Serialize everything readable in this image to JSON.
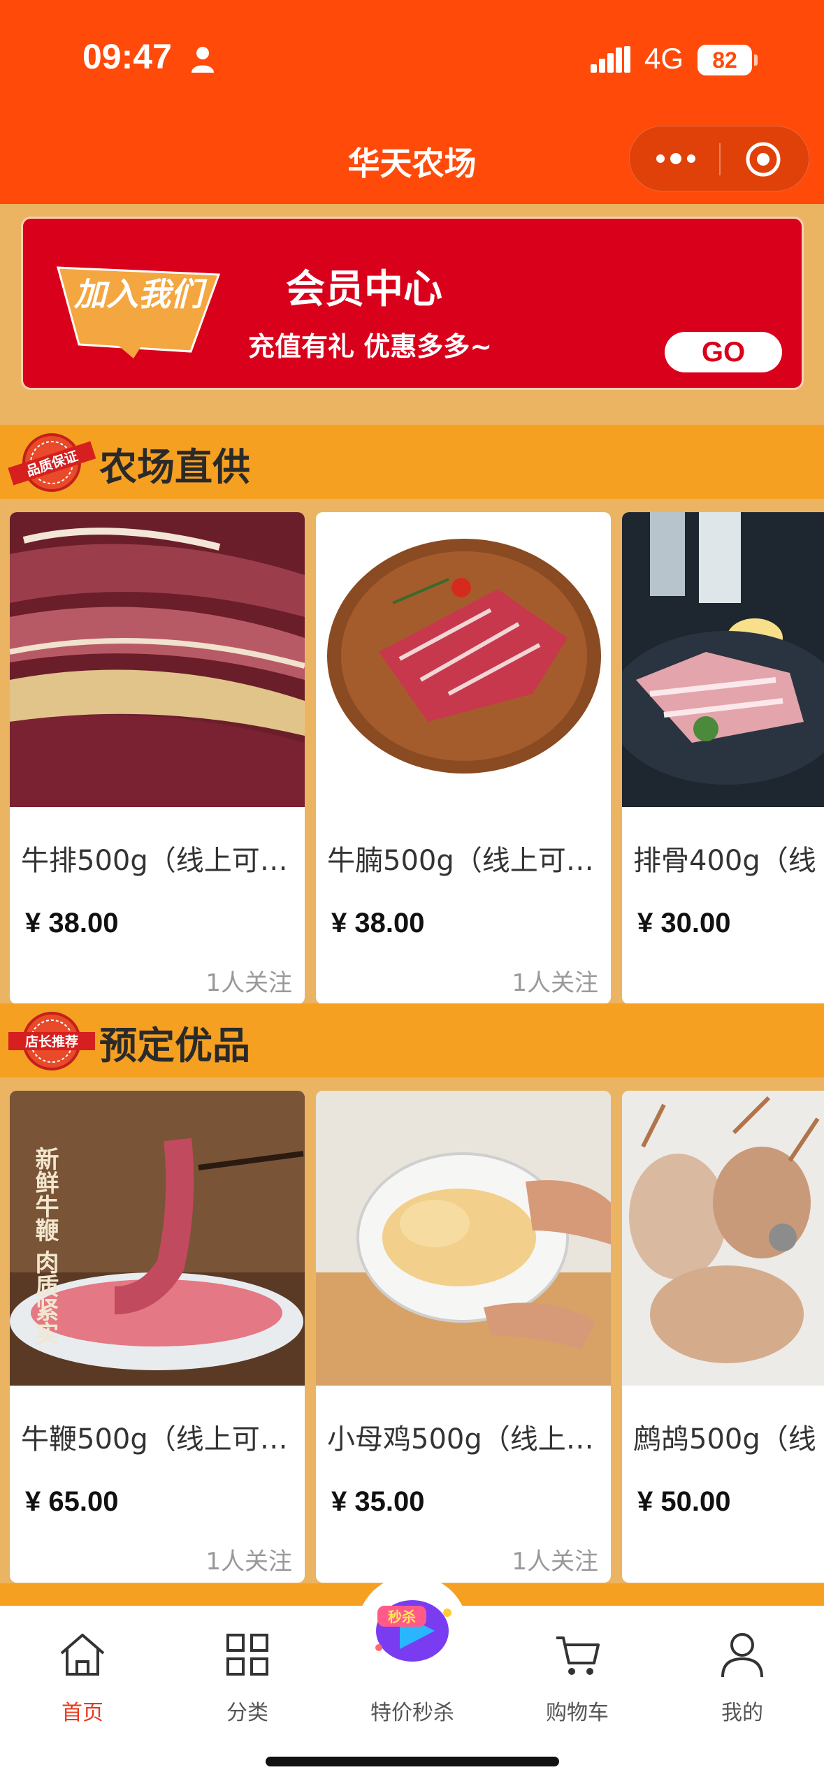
{
  "status": {
    "time": "09:47",
    "network": "4G",
    "battery": "82"
  },
  "nav": {
    "title": "华天农场"
  },
  "member": {
    "badge_text": "加入我们",
    "title": "会员中心",
    "subtitle": "充值有礼 优惠多多~",
    "go_label": "GO"
  },
  "sections": [
    {
      "badge": "品质保证",
      "title": "农场直供",
      "products": [
        {
          "name": "牛排500g（线上可…",
          "price": "¥ 38.00",
          "follow": "1人关注"
        },
        {
          "name": "牛腩500g（线上可…",
          "price": "¥ 38.00",
          "follow": "1人关注"
        },
        {
          "name": "排骨400g（线",
          "price": "¥ 30.00",
          "follow": ""
        }
      ]
    },
    {
      "badge": "店长推荐",
      "title": "预定优品",
      "products": [
        {
          "name": "牛鞭500g（线上可…",
          "price": "¥ 65.00",
          "follow": "1人关注",
          "overlay": "新鲜牛鞭 肉质紧实"
        },
        {
          "name": "小母鸡500g（线上…",
          "price": "¥ 35.00",
          "follow": "1人关注"
        },
        {
          "name": "鹧鸪500g（线",
          "price": "¥ 50.00",
          "follow": ""
        }
      ]
    }
  ],
  "tabbar": {
    "items": [
      {
        "label": "首页",
        "icon": "home-icon",
        "active": true
      },
      {
        "label": "分类",
        "icon": "grid-icon",
        "active": false
      },
      {
        "label": "特价秒杀",
        "icon": "flash-sale-icon",
        "active": false
      },
      {
        "label": "购物车",
        "icon": "cart-icon",
        "active": false
      },
      {
        "label": "我的",
        "icon": "user-icon",
        "active": false
      }
    ]
  },
  "colors": {
    "brand": "#ff4a0a",
    "section": "#f6a022",
    "banner": "#d9001b",
    "active_tab": "#e8381e"
  }
}
